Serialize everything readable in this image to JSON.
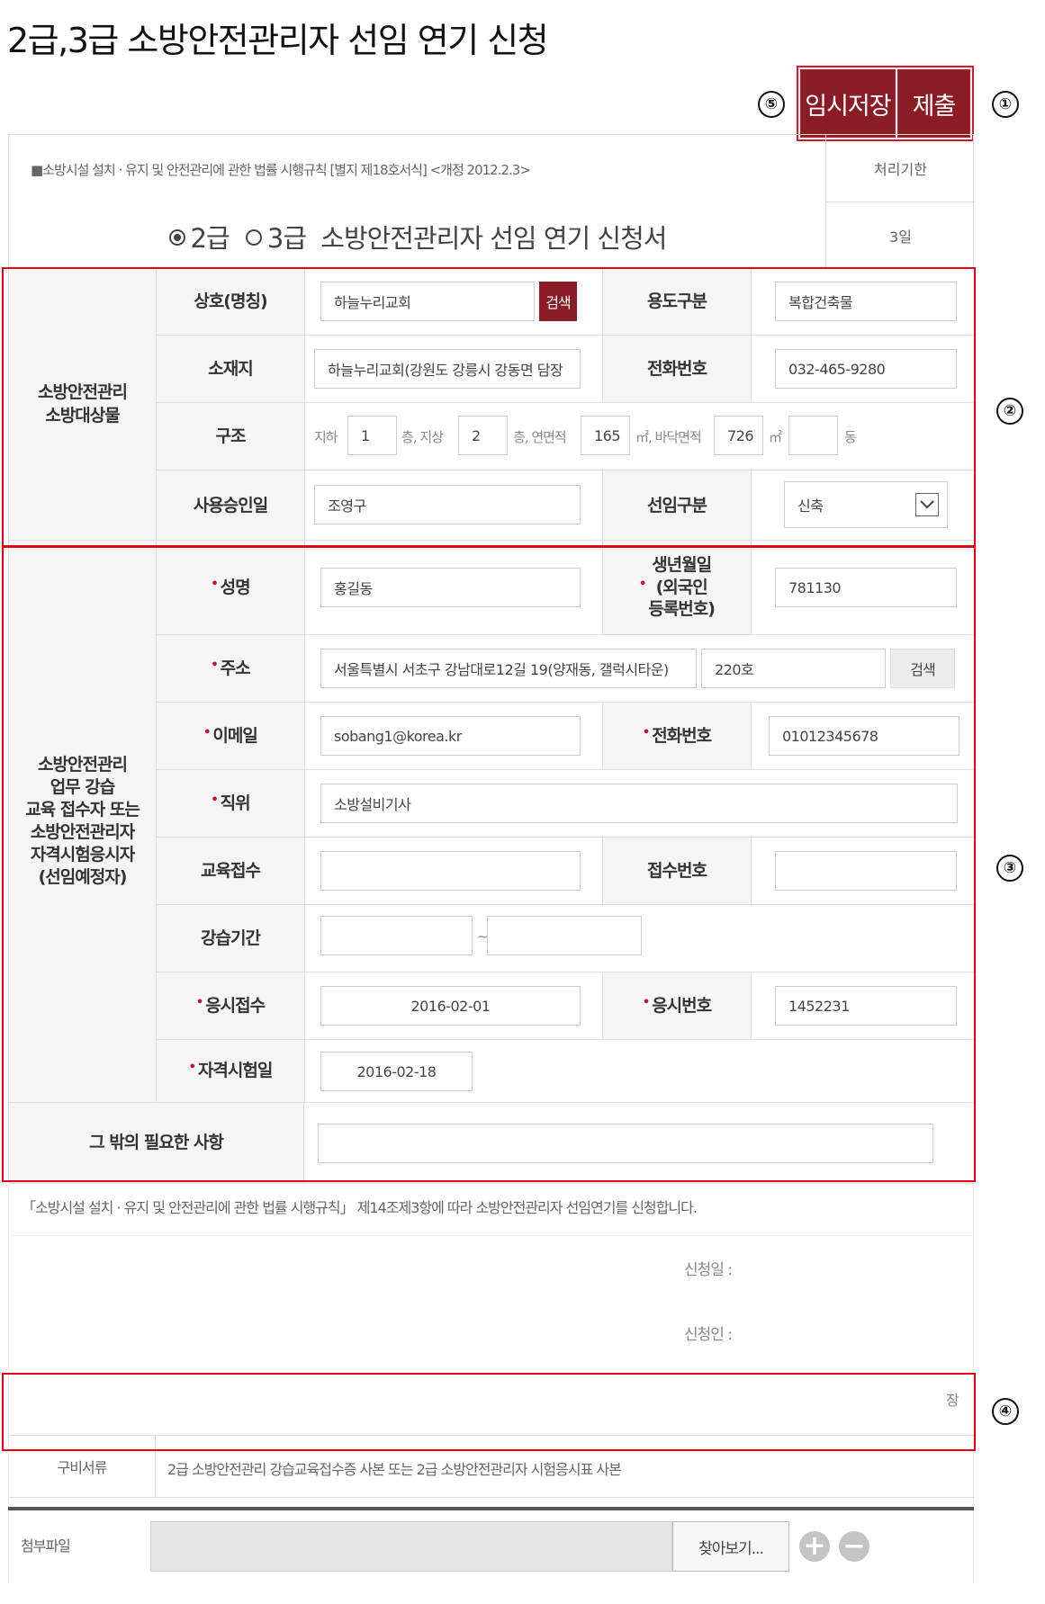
{
  "page": {
    "title": "2급,3급 소방안전관리자 선임 연기 신청"
  },
  "actions": {
    "save_label": "임시저장",
    "submit_label": "제출"
  },
  "markers": [
    "①",
    "②",
    "③",
    "④",
    "⑤"
  ],
  "header": {
    "law_ref": "■소방시설 설치 · 유지 및 안전관리에 관한 법률 시행규칙 [별지 제18호서식] <개정 2012.2.3>",
    "doc_title_part1": "2급",
    "doc_title_part2": "3급",
    "doc_title_rest": "소방안전관리자 선임 연기 신청서",
    "grade_selected": "2급",
    "processing_label": "처리기한",
    "processing_value": "3일"
  },
  "target": {
    "group_label": "소방안전관리\n소방대상물",
    "name_label": "상호(명칭)",
    "name_value": "하늘누리교회",
    "search_label": "검색",
    "usage_label": "용도구분",
    "usage_value": "복합건축물",
    "location_label": "소재지",
    "location_value": "하늘누리교회(강원도 강릉시 강동면 담장",
    "phone_label": "전화번호",
    "phone_value": "032-465-9280",
    "structure_label": "구조",
    "basement_txt": "지하",
    "basement_value": "1",
    "floor_above_txt": "층, 지상",
    "floor_above_value": "2",
    "total_area_txt": "층, 연면적",
    "total_area_value": "165",
    "floor_area_txt": "㎡, 바닥면적",
    "floor_area_value": "726",
    "unit_m2": "㎡",
    "building_count_value": "",
    "building_unit": "동",
    "approval_label": "사용승인일",
    "approval_value": "조영구",
    "appoint_label": "선임구분",
    "appoint_value": "신축"
  },
  "person": {
    "group_label": "소방안전관리\n업무 강습\n교육 접수자 또는\n소방안전관리자\n자격시험응시자\n(선임예정자)",
    "name_label": "성명",
    "name_value": "홍길동",
    "birth_label": "생년월일\n(외국인\n등록번호)",
    "birth_value": "781130",
    "address_label": "주소",
    "address_value": "서울특별시 서초구 강남대로12길 19(양재동, 갤럭시타운)",
    "address_detail": "220호",
    "address_search": "검색",
    "email_label": "이메일",
    "email_value": "sobang1@korea.kr",
    "phone_label": "전화번호",
    "phone_value": "01012345678",
    "position_label": "직위",
    "position_value": "소방설비기사",
    "edu_label": "교육접수",
    "edu_value": "",
    "receipt_label": "접수번호",
    "receipt_value": "",
    "period_label": "강습기간",
    "period_from": "",
    "period_sep": "~",
    "period_to": "",
    "exam_reg_label": "응시접수",
    "exam_reg_value": "2016-02-01",
    "exam_no_label": "응시번호",
    "exam_no_value": "1452231",
    "exam_date_label": "자격시험일",
    "exam_date_value": "2016-02-18",
    "required_mark": "•"
  },
  "other": {
    "label": "그 밖의 필요한 사항",
    "value": ""
  },
  "declaration": {
    "text": "「소방시설 설치 · 유지 및 안전관리에 관한 법률 시행규칙」 제14조제3항에 따라 소방안전관리자 선임연기를 신청합니다.",
    "date_label": "신청일 :",
    "applicant_label": "신청인 :",
    "seal": "장"
  },
  "documents": {
    "label": "구비서류",
    "value": "2급 소방안전관리 강습교육접수증 사본 또는 2급 소방안전관리자 시험응시표 사본"
  },
  "attachment": {
    "label": "첨부파일",
    "browse_label": "찾아보기...",
    "add": "+",
    "remove": "−"
  },
  "colors": {
    "brand": "#8b1b25",
    "highlight": "#e60012",
    "label_bg": "#f5f5f5"
  }
}
